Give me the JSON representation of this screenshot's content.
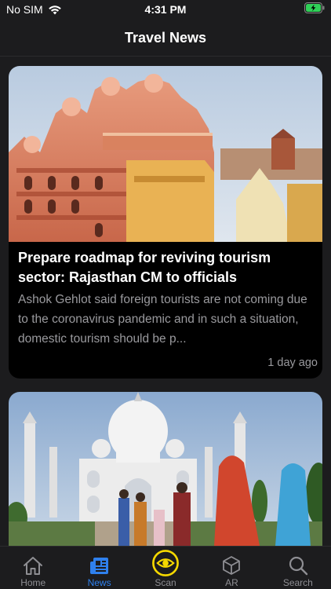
{
  "status_bar": {
    "carrier": "No SIM",
    "time": "4:31 PM",
    "battery_color": "#30d158"
  },
  "nav": {
    "title": "Travel News"
  },
  "articles": [
    {
      "title": "Prepare roadmap for reviving tourism sector: Rajasthan CM to officials",
      "summary": "Ashok Gehlot said foreign tourists are not coming due to the coronavirus pandemic and in such a situation, domestic tourism should be p...",
      "time": "1 day ago"
    },
    {
      "title": "",
      "summary": "",
      "time": ""
    }
  ],
  "tabs": [
    {
      "label": "Home",
      "icon": "house-icon",
      "active": false
    },
    {
      "label": "News",
      "icon": "newspaper-icon",
      "active": true
    },
    {
      "label": "Scan",
      "icon": "eye-scan-icon",
      "active": false
    },
    {
      "label": "AR",
      "icon": "cube-icon",
      "active": false
    },
    {
      "label": "Search",
      "icon": "magnifier-icon",
      "active": false
    }
  ],
  "colors": {
    "accent": "#2f80ed",
    "scan_ring": "#f5d800",
    "background": "#1c1c1e"
  }
}
